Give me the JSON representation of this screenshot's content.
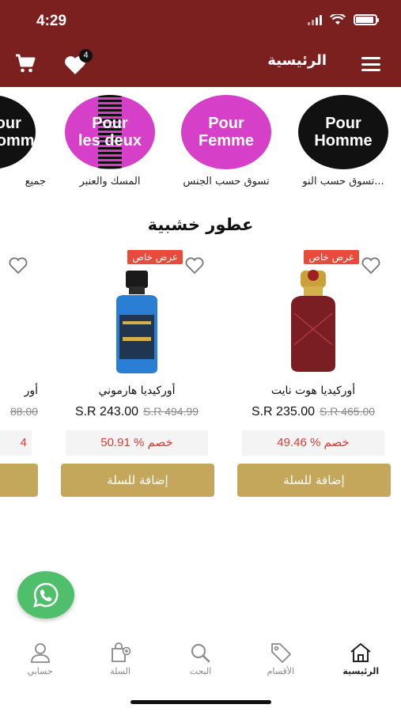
{
  "status_bar": {
    "time": "4:29"
  },
  "header": {
    "title": "الرئيسية",
    "wishlist_count": "4"
  },
  "categories": [
    {
      "circle_text_1": "Pour",
      "circle_text_2": "Homme",
      "label": "تسوق حسب النو...",
      "color": "#111111"
    },
    {
      "circle_text_1": "Pour",
      "circle_text_2": "Femme",
      "label": "تسوق حسب الجنس",
      "color": "#d63fc8"
    },
    {
      "circle_text_1": "Pour",
      "circle_text_2": "les deux",
      "label": "المسك والعنبر",
      "color": "#d63fc8"
    },
    {
      "circle_text_1": "Pour",
      "circle_text_2": "Homme",
      "label": "جميع",
      "color": "#111111"
    }
  ],
  "section": {
    "title": "عطور خشبية"
  },
  "products": [
    {
      "name": "أوركيديا هوت نايت",
      "price": "S.R 235.00",
      "old_price": "S.R 465.00",
      "discount": "49.46 % خصم",
      "badge": "عرض خاص",
      "add_label": "إضافة للسلة"
    },
    {
      "name": "أوركيديا هارموني",
      "price": "S.R 243.00",
      "old_price": "S.R 494.99",
      "discount": "50.91 % خصم",
      "badge": "عرض خاص",
      "add_label": "إضافة للسلة"
    },
    {
      "name": "أور",
      "price": "",
      "old_price": "88.00",
      "discount": "4",
      "badge": "",
      "add_label": ""
    }
  ],
  "bottom_nav": [
    {
      "label": "الرئيسية",
      "icon": "home-icon"
    },
    {
      "label": "الأقسام",
      "icon": "tag-icon"
    },
    {
      "label": "البحث",
      "icon": "search-icon"
    },
    {
      "label": "السلة",
      "icon": "bag-icon"
    },
    {
      "label": "حسابي",
      "icon": "user-icon"
    }
  ],
  "colors": {
    "header": "#7c1f1f",
    "accent": "#c4a75a",
    "badge": "#e84a3c",
    "discount_text": "#d93b35"
  }
}
